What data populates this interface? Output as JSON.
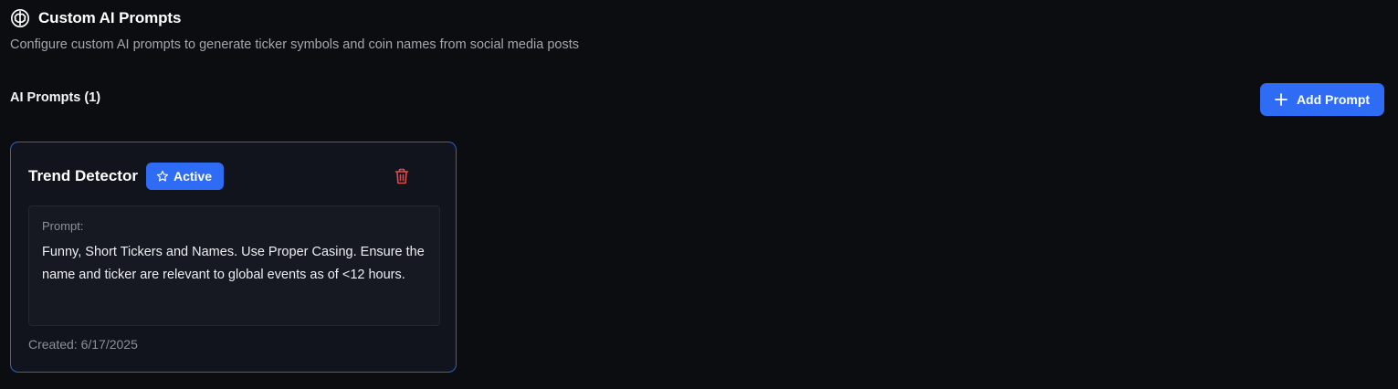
{
  "header": {
    "icon": "brain-icon",
    "title": "Custom AI Prompts",
    "subtitle": "Configure custom AI prompts to generate ticker symbols and coin names from social media posts"
  },
  "prompts_section": {
    "title": "AI Prompts (1)",
    "add_button_label": "Add Prompt",
    "add_button_icon": "plus-icon"
  },
  "prompts": [
    {
      "name": "Trend Detector",
      "badge_label": "Active",
      "badge_icon": "star-icon",
      "delete_icon": "trash-icon",
      "prompt_label": "Prompt:",
      "prompt_text": "Funny, Short Tickers and Names. Use Proper Casing. Ensure the name and ticker are relevant to global events as of <12 hours.",
      "created": "Created: 6/17/2025"
    }
  ],
  "colors": {
    "background": "#0c0d10",
    "accent": "#2f6cf5",
    "card_border": "#2e5fd6",
    "danger": "#e04a4a"
  }
}
